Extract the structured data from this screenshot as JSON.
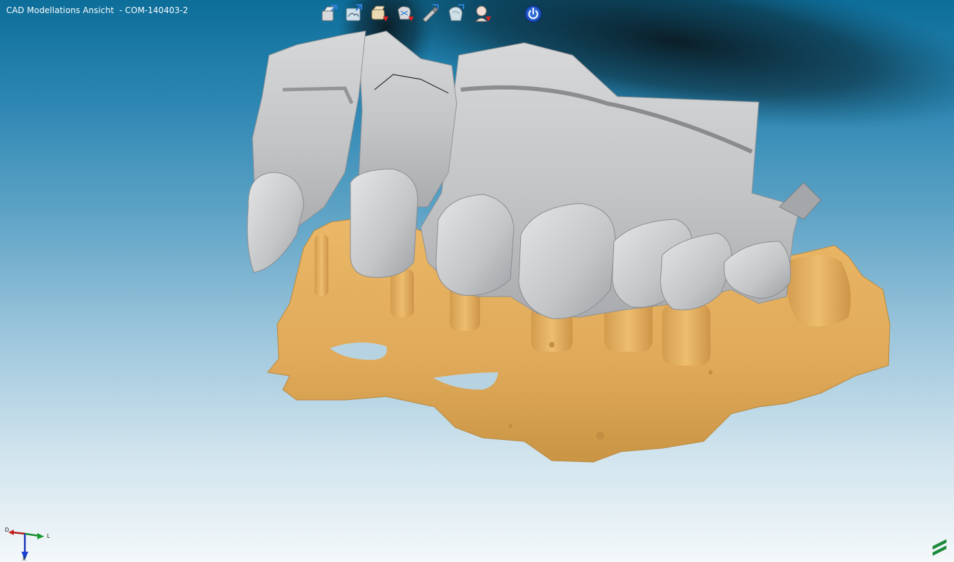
{
  "window": {
    "title": "CAD Modellations Ansicht  - COM-140403-2"
  },
  "toolbar": {
    "tools": [
      {
        "icon": "export-model-icon"
      },
      {
        "icon": "load-scan-icon"
      },
      {
        "icon": "remove-model-icon"
      },
      {
        "icon": "remove-crown-icon"
      },
      {
        "icon": "export-tool-icon"
      },
      {
        "icon": "export-shell-icon"
      },
      {
        "icon": "remove-patient-icon"
      },
      {
        "icon": "power-icon"
      }
    ]
  },
  "axis_indicator": {
    "labels": {
      "distal": "D",
      "lingual": "L",
      "axial": "X"
    }
  },
  "colors": {
    "upper_jaw": "#c7c9cb",
    "lower_jaw": "#e2ac5e",
    "background_top": "#0d6e9a",
    "background_bottom": "#f4f8fa",
    "power_button": "#1d4fb8",
    "logo": "#1c8a3c"
  }
}
